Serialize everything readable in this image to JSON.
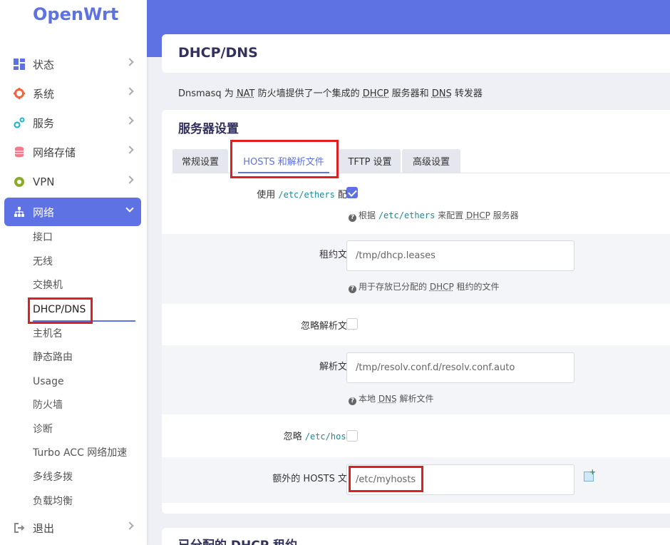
{
  "brand": "OpenWrt",
  "colors": {
    "accent": "#5e72e4",
    "highlight": "#e02020"
  },
  "nav": [
    {
      "label": "状态",
      "icon": "dashboard-icon"
    },
    {
      "label": "系统",
      "icon": "gear-icon"
    },
    {
      "label": "服务",
      "icon": "cogs-icon"
    },
    {
      "label": "网络存储",
      "icon": "database-icon"
    },
    {
      "label": "VPN",
      "icon": "vpn-icon"
    },
    {
      "label": "网络",
      "icon": "sitemap-icon"
    },
    {
      "label": "退出",
      "icon": "logout-icon"
    }
  ],
  "network_sub": [
    "接口",
    "无线",
    "交换机",
    "DHCP/DNS",
    "主机名",
    "静态路由",
    "Usage",
    "防火墙",
    "诊断",
    "Turbo ACC 网络加速",
    "多线多拨",
    "负载均衡"
  ],
  "page": {
    "title": "DHCP/DNS",
    "desc_parts": [
      "Dnsmasq 为 ",
      "NAT",
      " 防火墙提供了一个集成的 ",
      "DHCP",
      " 服务器和 ",
      "DNS",
      " 转发器"
    ]
  },
  "section": {
    "title": "服务器设置"
  },
  "tabs": [
    "常规设置",
    "HOSTS 和解析文件",
    "TFTP 设置",
    "高级设置"
  ],
  "fields": {
    "use_ethers": {
      "label_pre": "使用 ",
      "label_code": "/etc/ethers",
      "label_post": " 配置",
      "checked": true,
      "hint_pre": "根据 ",
      "hint_code": "/etc/ethers",
      "hint_mid": " 来配置 ",
      "hint_abbr": "DHCP",
      "hint_post": " 服务器"
    },
    "leasefile": {
      "label": "租约文件",
      "placeholder": "/tmp/dhcp.leases",
      "hint_pre": "用于存放已分配的 ",
      "hint_abbr": "DHCP",
      "hint_post": " 租约的文件"
    },
    "noresolv": {
      "label": "忽略解析文件",
      "checked": false
    },
    "resolvfile": {
      "label": "解析文件",
      "placeholder": "/tmp/resolv.conf.d/resolv.conf.auto",
      "hint_pre": "本地 ",
      "hint_abbr": "DNS",
      "hint_post": " 解析文件"
    },
    "nohosts": {
      "label_pre": "忽略 ",
      "label_code": "/etc/hosts",
      "checked": false
    },
    "addnhosts": {
      "label": "额外的 HOSTS 文件",
      "placeholder": "/etc/myhosts"
    }
  },
  "bottom": {
    "title": "已分配的 DHCP 租约"
  }
}
